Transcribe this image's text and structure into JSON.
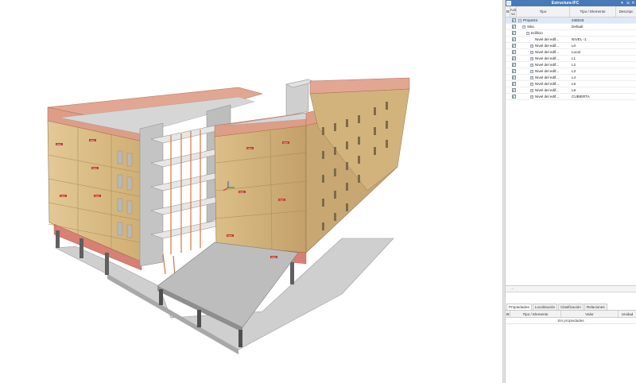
{
  "panel": {
    "title": "Estructura IFC",
    "controls": {
      "pin": "▾",
      "float": "⇲",
      "close": "✕"
    },
    "columns": {
      "filter": "⊟",
      "active": "Acti vo",
      "type": "Tipo",
      "element": "Tipo / Elemento",
      "description": "Descripc"
    },
    "rows": [
      {
        "expander": "−",
        "type": "Proyecto",
        "element": "248243"
      },
      {
        "expander": "−",
        "type": "Sitio",
        "element": "Default"
      },
      {
        "expander": "−",
        "type": "Edificio",
        "element": ""
      },
      {
        "expander": "",
        "type": "Nivel del edif...",
        "element": "NIVEL -1"
      },
      {
        "expander": "+",
        "type": "Nivel del edif...",
        "element": "L0"
      },
      {
        "expander": "+",
        "type": "Nivel del edif...",
        "element": "Local"
      },
      {
        "expander": "+",
        "type": "Nivel del edif...",
        "element": "L1"
      },
      {
        "expander": "+",
        "type": "Nivel del edif...",
        "element": "L2"
      },
      {
        "expander": "+",
        "type": "Nivel del edif...",
        "element": "L3"
      },
      {
        "expander": "+",
        "type": "Nivel del edif...",
        "element": "L4"
      },
      {
        "expander": "+",
        "type": "Nivel del edif...",
        "element": "L5"
      },
      {
        "expander": "+",
        "type": "Nivel del edif...",
        "element": "L6"
      },
      {
        "expander": "+",
        "type": "Nivel del edif...",
        "element": "CUBIERTA"
      }
    ],
    "tabs": [
      "Propiedades",
      "Localización",
      "Clasificación",
      "Relaciones"
    ],
    "props_columns": {
      "filter": "⊟",
      "type": "Tipo / Elemento",
      "value": "Valor",
      "unit": "Unidad"
    },
    "empty_text": "Sin propiedades",
    "splitter_grip": "⋯"
  },
  "viewport": {
    "facade_label": "PANEL",
    "colors": {
      "beige": "#d9bd86",
      "terracotta": "#dd9d86",
      "concrete": "#c9c9c9",
      "slab": "#d4d4d4",
      "column": "#5f5f5f",
      "accent": "#4a79b8"
    }
  }
}
